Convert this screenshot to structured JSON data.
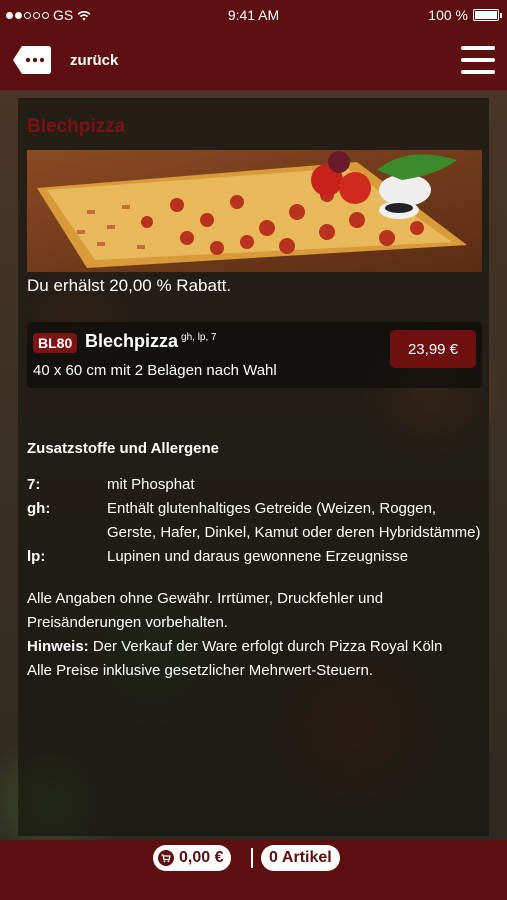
{
  "status_bar": {
    "carrier": "GS",
    "time": "9:41 AM",
    "battery": "100 %",
    "battery_level": 1.0
  },
  "nav": {
    "back_label": "zurück"
  },
  "section": {
    "title": "Blechpizza"
  },
  "discount_text": "Du erhälst 20,00 % Rabatt.",
  "product": {
    "code": "BL80",
    "name": "Blechpizza",
    "allergen_codes": "gh, lp, 7",
    "description": "40 x 60 cm mit 2 Belägen nach Wahl",
    "price": "23,99 €"
  },
  "allergens": {
    "heading": "Zusatzstoffe und Allergene",
    "items": [
      {
        "key": "7:",
        "value": "mit Phosphat"
      },
      {
        "key": "gh:",
        "value": "Enthält glutenhaltiges Getreide (Weizen, Roggen, Gerste, Hafer, Dinkel, Kamut oder deren Hybridstämme)"
      },
      {
        "key": "lp:",
        "value": "Lupinen und daraus gewonnene Erzeugnisse"
      }
    ]
  },
  "disclaimer": {
    "line1": "Alle Angaben ohne Gewähr. Irrtümer, Druckfehler und Preisänderungen vorbehalten.",
    "hint_label": "Hinweis:",
    "hint_text": "Der Verkauf der Ware erfolgt durch Pizza Royal Köln",
    "line3": "Alle Preise inklusive gesetzlicher Mehrwert-Steuern."
  },
  "footer": {
    "cart_total": "0,00 €",
    "items_count": "0",
    "items_label": "Artikel"
  },
  "colors": {
    "brand": "#5e1010",
    "accent": "#7d1414"
  },
  "icons": {
    "back": "back-tag-icon",
    "menu": "hamburger-menu-icon",
    "cart": "cart-icon"
  }
}
